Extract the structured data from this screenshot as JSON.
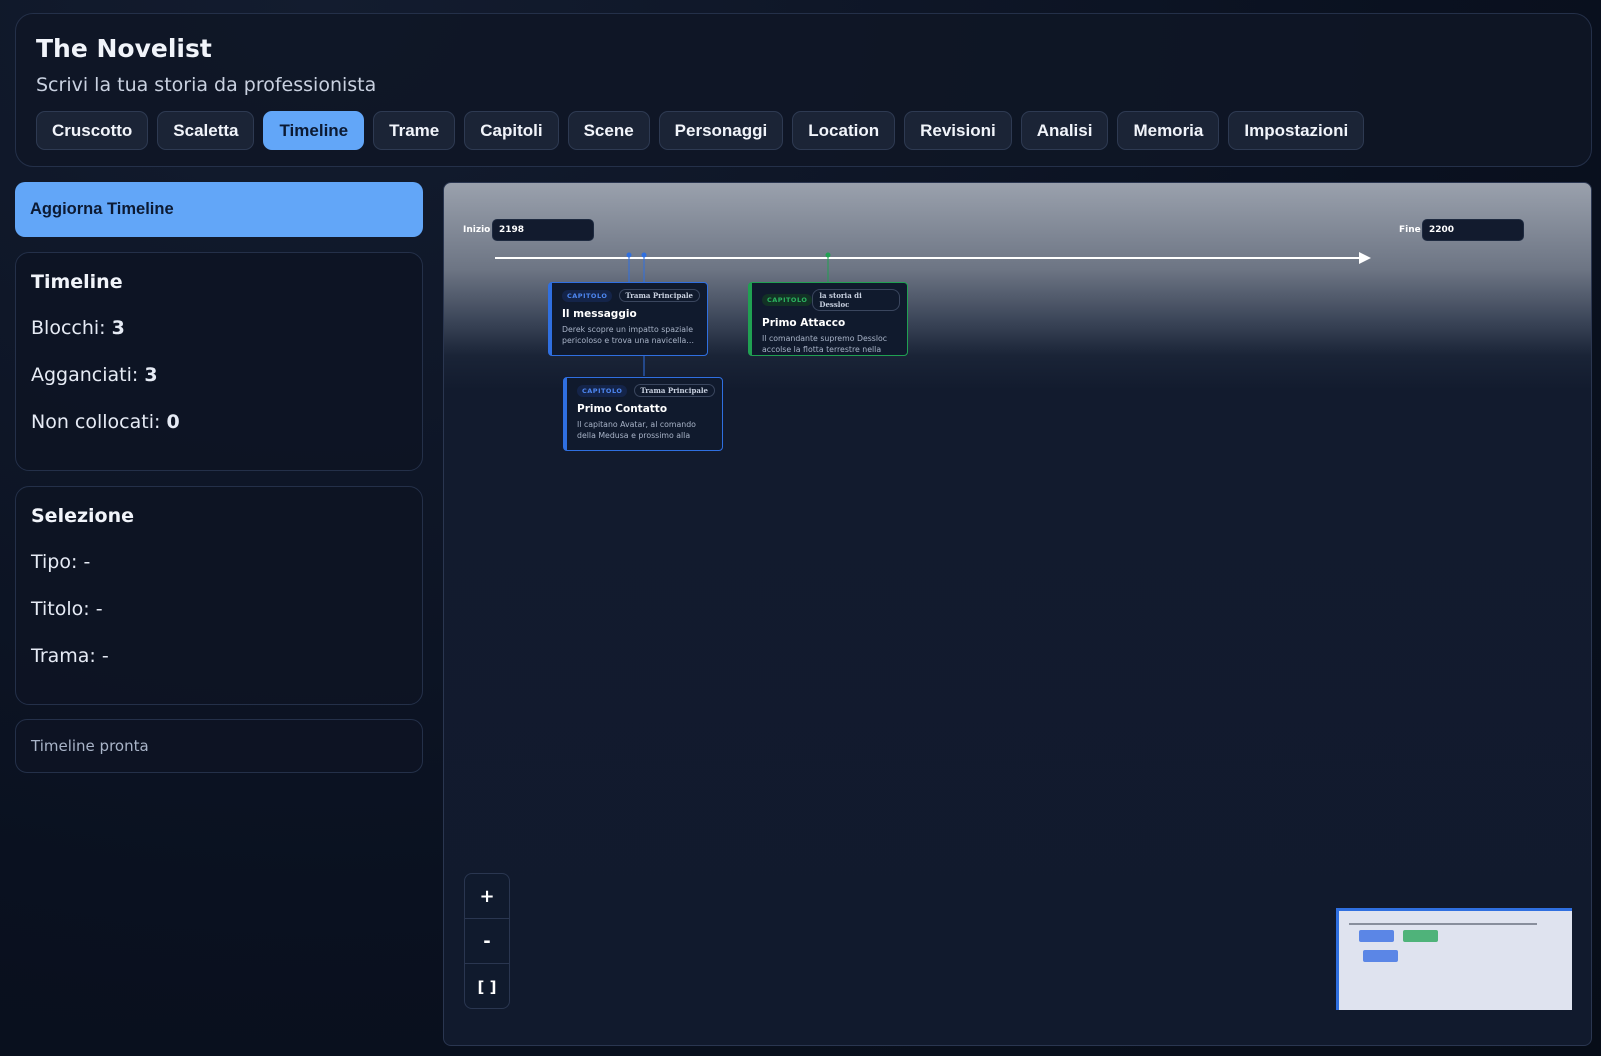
{
  "app": {
    "title": "The Novelist",
    "subtitle": "Scrivi la tua storia da professionista"
  },
  "tabs": [
    {
      "label": "Cruscotto",
      "active": false
    },
    {
      "label": "Scaletta",
      "active": false
    },
    {
      "label": "Timeline",
      "active": true
    },
    {
      "label": "Trame",
      "active": false
    },
    {
      "label": "Capitoli",
      "active": false
    },
    {
      "label": "Scene",
      "active": false
    },
    {
      "label": "Personaggi",
      "active": false
    },
    {
      "label": "Location",
      "active": false
    },
    {
      "label": "Revisioni",
      "active": false
    },
    {
      "label": "Analisi",
      "active": false
    },
    {
      "label": "Memoria",
      "active": false
    },
    {
      "label": "Impostazioni",
      "active": false
    }
  ],
  "sidebar": {
    "refresh_label": "Aggiorna Timeline",
    "timeline_card": {
      "title": "Timeline",
      "blocks_label": "Blocchi:",
      "blocks_value": "3",
      "attached_label": "Agganciati:",
      "attached_value": "3",
      "unplaced_label": "Non collocati:",
      "unplaced_value": "0"
    },
    "selection_card": {
      "title": "Selezione",
      "type_label": "Tipo:",
      "type_value": "-",
      "title_label": "Titolo:",
      "title_value": "-",
      "plot_label": "Trama:",
      "plot_value": "-"
    },
    "status": "Timeline pronta"
  },
  "timeline": {
    "start_label": "Inizio",
    "start_value": "2198",
    "end_label": "Fine",
    "end_value": "2200",
    "nodes": [
      {
        "type": "CAPITOLO",
        "plot": "Trama Principale",
        "title": "Il messaggio",
        "description": "Derek scopre un impatto spaziale pericoloso e trova una navicella…",
        "color": "#2f6fe0"
      },
      {
        "type": "CAPITOLO",
        "plot": "la storia di Dessloc",
        "title": "Primo Attacco",
        "description": "Il comandante supremo Dessloc accolse la flotta terrestre nella zona…",
        "color": "#20a052"
      },
      {
        "type": "CAPITOLO",
        "plot": "Trama Principale",
        "title": "Primo Contatto",
        "description": "Il capitano Avatar, al comando della Medusa e prossimo alla pensione,…",
        "color": "#2f6fe0"
      }
    ],
    "zoom": {
      "in_label": "+",
      "out_label": "-",
      "fit_label": "[ ]"
    }
  },
  "colors": {
    "accent": "#62a6f8",
    "plot_main": "#2f6fe0",
    "plot_dessloc": "#20a052"
  }
}
